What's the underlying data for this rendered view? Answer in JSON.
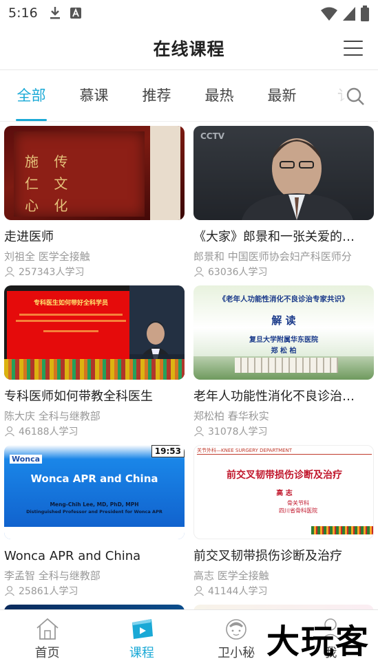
{
  "status_bar": {
    "time": "5:16",
    "icons": [
      "download-icon",
      "font-badge-icon",
      "wifi-icon",
      "signal-icon",
      "battery-icon"
    ]
  },
  "header": {
    "title": "在线课程",
    "menu_icon": "hamburger-menu-icon"
  },
  "tabs": [
    {
      "label": "全部",
      "active": true
    },
    {
      "label": "慕课",
      "active": false
    },
    {
      "label": "推荐",
      "active": false
    },
    {
      "label": "最热",
      "active": false
    },
    {
      "label": "最新",
      "active": false
    },
    {
      "label": "讠",
      "active": false
    }
  ],
  "courses": [
    {
      "title": "走进医师",
      "meta": "刘祖全  医学全接触",
      "count": "257343人学习",
      "thumb_chars": [
        "施 传",
        "仁 文",
        "心 化"
      ]
    },
    {
      "title": "《大家》郎景和一张关爱的…",
      "meta": "郎景和  中国医师协会妇产科医师分",
      "count": "63036人学习",
      "thumb_text": "CCTV"
    },
    {
      "title": "专科医师如何带教全科医生",
      "meta": "陈大庆  全科与继教部",
      "count": "46188人学习",
      "thumb_text": "专科医生如何带好全科学员"
    },
    {
      "title": "老年人功能性消化不良诊治…",
      "meta": "郑松柏  春华秋实",
      "count": "31078人学习",
      "thumb_title": "《老年人功能性消化不良诊治专家共识》",
      "thumb_heading": "解 读",
      "thumb_sub": "复旦大学附属华东医院",
      "thumb_name": "郑 松 柏"
    },
    {
      "title": "Wonca APR and China",
      "meta": "李孟智  全科与继教部",
      "count": "25861人学习",
      "thumb_brand": "Wonca",
      "thumb_heading": "Wonca APR and China",
      "thumb_line1": "Meng-Chih Lee, MD, PhD, MPH",
      "thumb_line2": "Distinguished Professor and President for  Wonca APR",
      "duration": "19:53"
    },
    {
      "title": "前交叉韧带损伤诊断及治疗",
      "meta": "高志  医学全接触",
      "count": "41144人学习",
      "thumb_header": "关节外科—KNEE SURGERY DEPARTMENT",
      "thumb_heading": "前交叉韧带损伤诊断及治疗",
      "thumb_name": "高 志",
      "thumb_sub1": "骨关节科",
      "thumb_sub2": "四川省骨科医院"
    }
  ],
  "bottom_nav": [
    {
      "label": "首页",
      "icon": "home-icon",
      "active": false
    },
    {
      "label": "课程",
      "icon": "course-play-icon",
      "active": true
    },
    {
      "label": "卫小秘",
      "icon": "nurse-avatar-icon",
      "active": false
    },
    {
      "label": "我",
      "icon": "profile-icon",
      "active": false
    }
  ],
  "watermark": "大玩客",
  "colors": {
    "accent": "#1aa9d6",
    "text": "#222222",
    "meta": "#999999"
  }
}
